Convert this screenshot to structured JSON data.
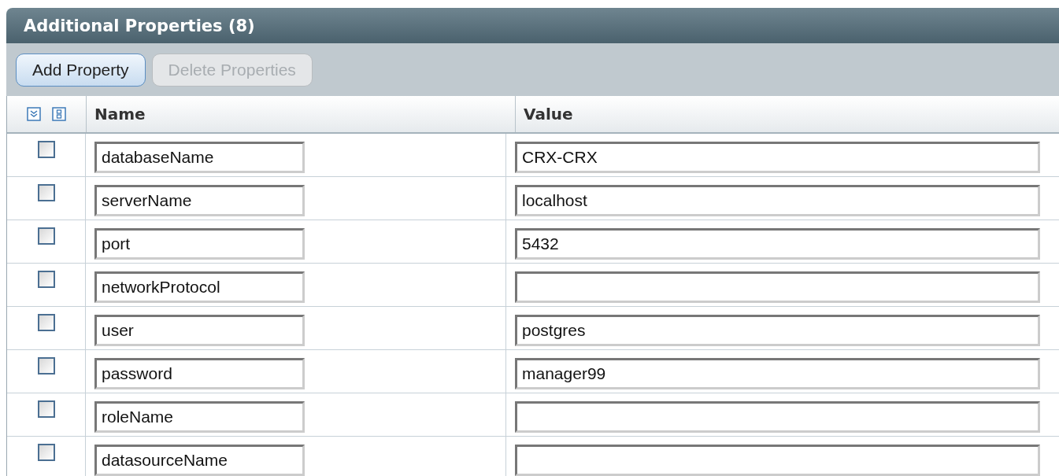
{
  "title": "Additional Properties (8)",
  "buttons": [
    {
      "label": "Add Property",
      "disabled": false
    },
    {
      "label": "Delete Properties",
      "disabled": true
    }
  ],
  "table": {
    "columns": [
      "Name",
      "Value"
    ],
    "rows": [
      {
        "checked": false,
        "name": "databaseName",
        "value": "CRX-CRX"
      },
      {
        "checked": false,
        "name": "serverName",
        "value": "localhost"
      },
      {
        "checked": false,
        "name": "port",
        "value": "5432"
      },
      {
        "checked": false,
        "name": "networkProtocol",
        "value": ""
      },
      {
        "checked": false,
        "name": "user",
        "value": "postgres"
      },
      {
        "checked": false,
        "name": "password",
        "value": "manager99"
      },
      {
        "checked": false,
        "name": "roleName",
        "value": ""
      },
      {
        "checked": false,
        "name": "datasourceName",
        "value": ""
      }
    ]
  }
}
